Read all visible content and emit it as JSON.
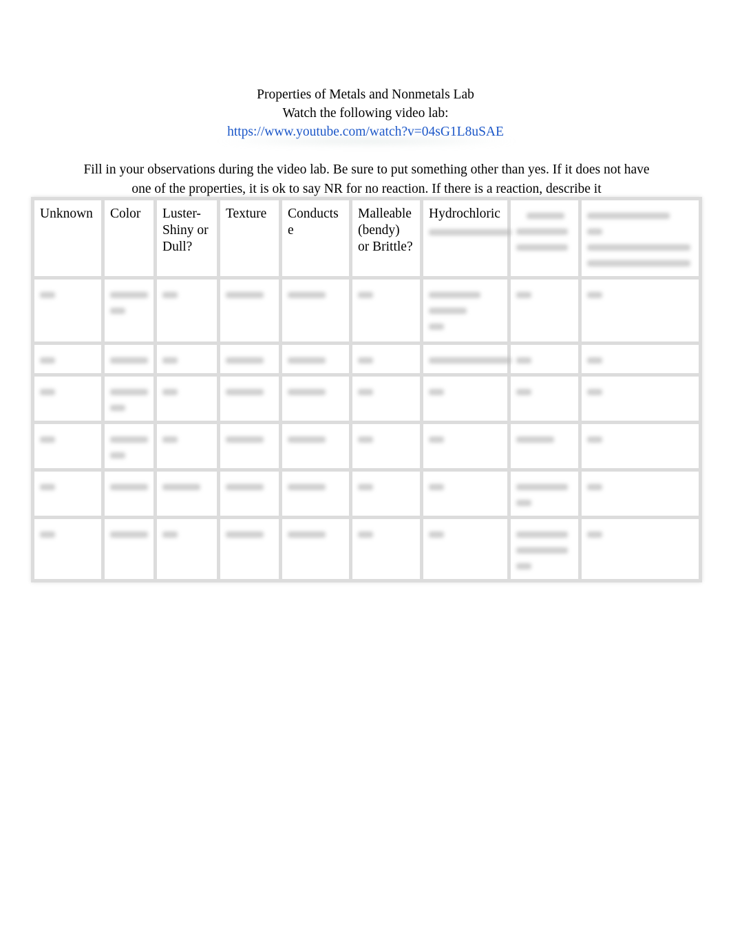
{
  "document": {
    "title": "Properties of Metals and Nonmetals Lab",
    "subtitle": "Watch the following video lab:",
    "video_link": "https://www.youtube.com/watch?v=04sG1L8uSAE",
    "instructions": "Fill in your observations during the video lab. Be sure to put something other than yes. If it does not have one of the properties, it is ok to say NR for no reaction. If there is a reaction, describe it",
    "link_color": "#1a56c8"
  },
  "table": {
    "headers": [
      "Unknown",
      "Color",
      "Luster-\nShiny or\nDull?",
      "Texture",
      "Conducts\ne",
      "Malleable\n(bendy)\nor Brittle?",
      "Hydrochloric",
      "",
      ""
    ],
    "blurred_note": "Remaining header text and all row contents are blurred / unreadable in the screenshot",
    "row_count": 6
  }
}
